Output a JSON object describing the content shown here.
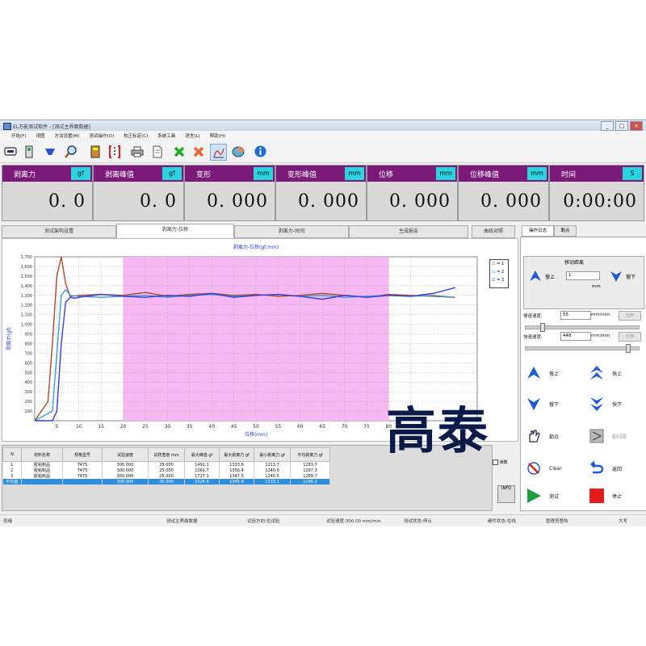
{
  "window": {
    "title": "EL万能测试软件 - [测试主界面数据]",
    "controls": [
      "_",
      "□",
      "×"
    ]
  },
  "menu": [
    "开始(F)",
    "视图",
    "方法设置(M)",
    "测试操作(O)",
    "校正标定(C)",
    "系统工具",
    "语言(L)",
    "帮助(H)"
  ],
  "toolbar_icons": [
    "monitor-icon",
    "device-icon",
    "cup-icon",
    "magnifier-icon",
    "book-icon",
    "red-bracket-icon",
    "printer-icon",
    "document-icon",
    "green-x-icon",
    "orange-x-icon",
    "curve-icon",
    "chart-icon",
    "info-icon"
  ],
  "readouts": [
    {
      "label": "剥离力",
      "unit": "gf",
      "value": "0. 0"
    },
    {
      "label": "剥离峰值",
      "unit": "gf",
      "value": "0. 0"
    },
    {
      "label": "变形",
      "unit": "mm",
      "value": "0. 000"
    },
    {
      "label": "变形峰值",
      "unit": "mm",
      "value": "0. 000"
    },
    {
      "label": "位移",
      "unit": "mm",
      "value": "0. 000"
    },
    {
      "label": "位移峰值",
      "unit": "mm",
      "value": "0. 000"
    },
    {
      "label": "时间",
      "unit": "S",
      "value": "0:00:00"
    }
  ],
  "tabs": [
    "测试架构设置",
    "剥离力-位移",
    "剥离力-时间",
    "生成报告"
  ],
  "curve_button": "曲线对照",
  "colors": {
    "accent_header": "#7b1a78",
    "unit_badge": "#29d3e0",
    "highlight_region": "#f6b8f2",
    "selected_row": "#2e8fe0"
  },
  "chart_data": {
    "type": "line",
    "title": "剥离力-位移(gf,mm)",
    "xlabel": "位移(mm)",
    "ylabel": "剥离力(gf)",
    "xlim": [
      0,
      100
    ],
    "ylim": [
      0,
      1700
    ],
    "xticks": [
      5,
      10,
      15,
      20,
      25,
      30,
      35,
      40,
      45,
      50,
      55,
      60,
      65,
      70,
      75,
      80,
      85
    ],
    "yticks": [
      100,
      200,
      300,
      400,
      500,
      600,
      700,
      800,
      900,
      "1,000",
      "1,100",
      "1,200",
      "1,300",
      "1,400",
      "1,500",
      "1,600",
      "1,700"
    ],
    "highlight_range": [
      20,
      80
    ],
    "grid": true,
    "legend": [
      "1",
      "2",
      "3"
    ],
    "series": [
      {
        "name": "1",
        "color": "#b04a2a",
        "x": [
          0,
          3,
          4,
          5,
          6,
          7,
          8,
          10,
          15,
          20,
          25,
          30,
          35,
          40,
          45,
          50,
          55,
          60,
          65,
          70,
          75,
          80,
          85,
          90,
          95
        ],
        "y": [
          0,
          200,
          800,
          1500,
          1700,
          1420,
          1290,
          1300,
          1310,
          1300,
          1330,
          1290,
          1310,
          1320,
          1300,
          1310,
          1290,
          1300,
          1320,
          1300,
          1280,
          1310,
          1300,
          1290,
          1280
        ]
      },
      {
        "name": "2",
        "color": "#33a0d8",
        "x": [
          0,
          4,
          5,
          6,
          7,
          8,
          10,
          15,
          20,
          25,
          30,
          35,
          40,
          45,
          50,
          55,
          60,
          65,
          70,
          75,
          80,
          85,
          90,
          95
        ],
        "y": [
          0,
          100,
          700,
          1300,
          1360,
          1300,
          1290,
          1280,
          1290,
          1300,
          1280,
          1300,
          1310,
          1290,
          1300,
          1310,
          1290,
          1300,
          1280,
          1290,
          1300,
          1290,
          1300,
          1280
        ]
      },
      {
        "name": "3",
        "color": "#3a3ad8",
        "x": [
          0,
          4,
          5,
          6,
          7,
          8,
          9,
          10,
          15,
          20,
          25,
          30,
          35,
          40,
          45,
          50,
          55,
          60,
          65,
          70,
          75,
          80,
          85,
          90,
          95
        ],
        "y": [
          0,
          0,
          100,
          800,
          1230,
          1280,
          1270,
          1280,
          1310,
          1290,
          1280,
          1300,
          1290,
          1320,
          1280,
          1300,
          1310,
          1290,
          1260,
          1300,
          1280,
          1300,
          1290,
          1320,
          1380
        ]
      }
    ]
  },
  "table": {
    "headers": [
      "N",
      "材料名称",
      "规格型号",
      "试验速度",
      "试样宽度\nmm",
      "最大峰值\ngf",
      "最大剥离力\ngf",
      "最小剥离力\ngf",
      "平均剥离力\ngf"
    ],
    "rows": [
      [
        "1",
        "胶粘制品",
        "T475",
        "300.000",
        "25.000",
        "1491.1",
        "1333.6",
        "1213.7",
        "1283.7"
      ],
      [
        "2",
        "胶粘制品",
        "T475",
        "300.000",
        "25.000",
        "1361.7",
        "1356.4",
        "1240.0",
        "1297.3"
      ],
      [
        "3",
        "胶粘制品",
        "T475",
        "300.000",
        "25.000",
        "1727.1",
        "1347.5",
        "1245.5",
        "1289.7"
      ]
    ],
    "avg_row": [
      "平均值",
      "",
      "",
      "300.000",
      "25.000",
      "1526.6",
      "1345.8",
      "1233.1",
      "1290.2"
    ]
  },
  "table_side": {
    "label": "读数",
    "icon_label": "INFO"
  },
  "right_panel": {
    "tabs": [
      "操作日志",
      "勒点"
    ],
    "move_title": "移动距离",
    "move_up": "慢上",
    "move_value": "1",
    "move_unit": "mm",
    "move_down": "慢下",
    "slow_speed_label": "慢速速度:",
    "slow_speed_value": "55",
    "fast_speed_label": "快速速度:",
    "fast_speed_value": "448",
    "speed_unit": "mm/min",
    "apply": "应用",
    "buttons": [
      "慢上",
      "快上",
      "慢下",
      "快下",
      "勒点",
      "勒归零",
      "Clear",
      "返回",
      "测试",
      "停止"
    ]
  },
  "status": [
    "就绪",
    "测试主界面数据",
    "试验方向:拉试验",
    "试验速度:300.00 mm/min",
    "测试状态:停止",
    "硬件状态:在线",
    "管理员登陆",
    "大写"
  ],
  "watermark": "高泰"
}
